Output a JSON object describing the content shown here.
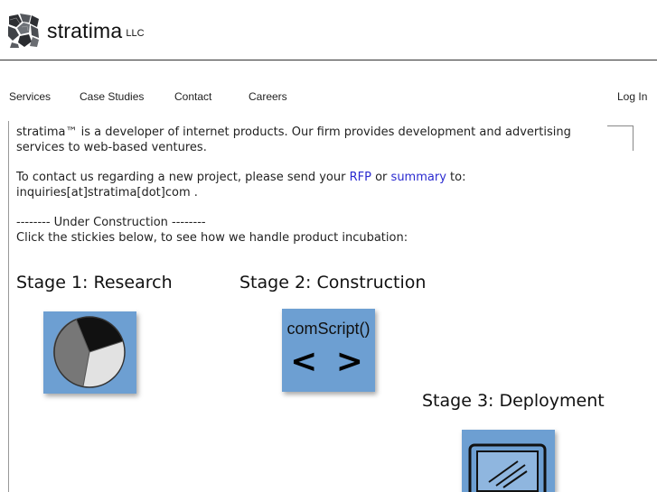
{
  "brand": {
    "name": "stratima",
    "suffix": "LLC",
    "logo_icon": "stone-cluster-icon"
  },
  "nav": {
    "items": [
      {
        "label": "Services"
      },
      {
        "label": "Case Studies"
      },
      {
        "label": "Contact"
      },
      {
        "label": "Careers"
      }
    ],
    "login_label": "Log In"
  },
  "content": {
    "intro": "stratima™ is a developer of internet products. Our firm provides development and advertising services to web-based ventures.",
    "contact_before": "To contact us regarding a new project, please send your ",
    "rfp_link": "RFP",
    "or_text": " or ",
    "summary_link": "summary",
    "contact_after": " to:",
    "email": "inquiries[at]stratima[dot]com .",
    "construction_notice": "-------- Under Construction --------",
    "instructions": "Click the stickies below, to see how we handle product incubation:"
  },
  "stages": [
    {
      "title": "Stage 1: Research",
      "icon": "pie-chart-icon"
    },
    {
      "title": "Stage 2: Construction",
      "icon": "code-brackets-icon",
      "sticky_label": "comScript()",
      "sticky_symbol": "< >"
    },
    {
      "title": "Stage 3: Deployment",
      "icon": "monitor-icon"
    }
  ],
  "colors": {
    "sticky_blue": "#6d9fd2",
    "link_blue": "#2a2ad0"
  }
}
